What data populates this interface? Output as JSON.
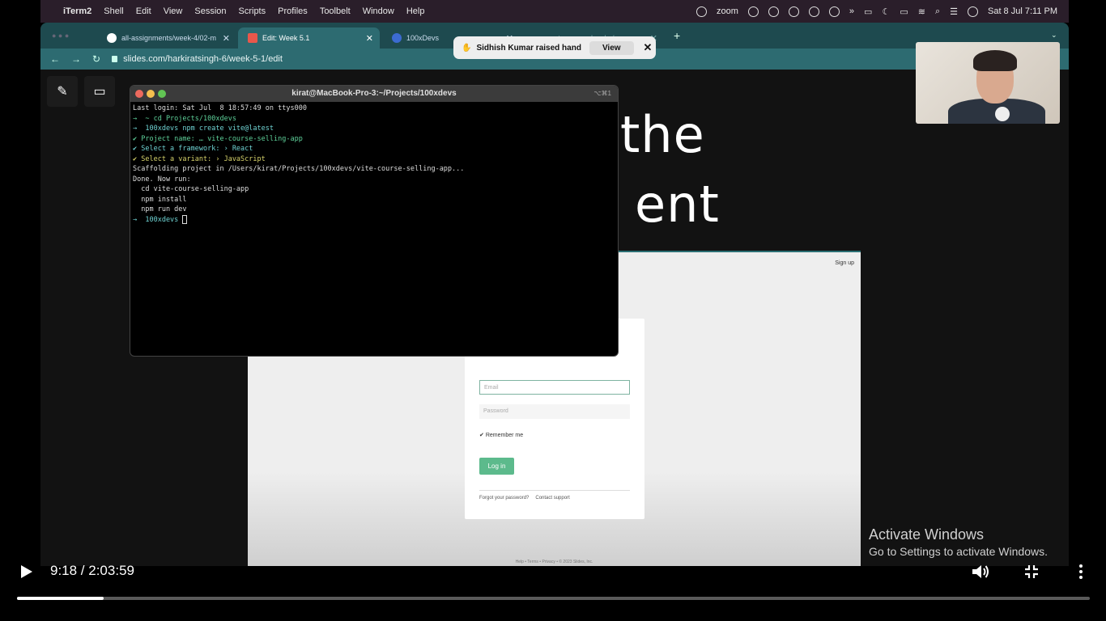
{
  "menubar": {
    "app": "iTerm2",
    "items": [
      "Shell",
      "Edit",
      "View",
      "Session",
      "Scripts",
      "Profiles",
      "Toolbelt",
      "Window",
      "Help"
    ],
    "zoom_label": "zoom",
    "datetime": "Sat 8 Jul  7:11 PM"
  },
  "browser": {
    "tabs": [
      {
        "label": "all-assignments/week-4/02-m"
      },
      {
        "label": "Edit: Week 5.1"
      },
      {
        "label": "100xDevs"
      },
      {
        "label": "creator-sourcelocal.../course"
      }
    ],
    "url": "slides.com/harkiratsingh-6/week-5-1/edit"
  },
  "notification": {
    "text": "Sidhish Kumar raised hand",
    "view_label": "View"
  },
  "slide": {
    "line1": "the",
    "line2": "ent"
  },
  "login_page": {
    "signup": "Sign up",
    "email_placeholder": "Email",
    "password_placeholder": "Password",
    "remember": "Remember me",
    "login_button": "Log in",
    "forgot": "Forgot your password?",
    "support": "Contact support",
    "footer": "Help  •  Terms  •  Privacy  •  © 2023 Slides, Inc."
  },
  "terminal": {
    "title": "kirat@MacBook-Pro-3:~/Projects/100xdevs",
    "shortcut": "⌥⌘1",
    "lines": [
      "Last login: Sat Jul  8 18:57:49 on ttys000",
      "→  ~ cd Projects/100xdevs",
      "→  100xdevs npm create vite@latest",
      "✔ Project name: … vite-course-selling-app",
      "✔ Select a framework: › React",
      "✔ Select a variant: › JavaScript",
      "",
      "Scaffolding project in /Users/kirat/Projects/100xdevs/vite-course-selling-app...",
      "",
      "Done. Now run:",
      "",
      "  cd vite-course-selling-app",
      "  npm install",
      "  npm run dev",
      "",
      "→  100xdevs "
    ]
  },
  "activate": {
    "title": "Activate Windows",
    "subtitle": "Go to Settings to activate Windows."
  },
  "player": {
    "time": "9:18 / 2:03:59",
    "progress_fraction": 0.081
  },
  "colors": {
    "tabbar": "#1e4a4f",
    "accent": "#2d6b71",
    "login_button": "#5cba8c"
  }
}
